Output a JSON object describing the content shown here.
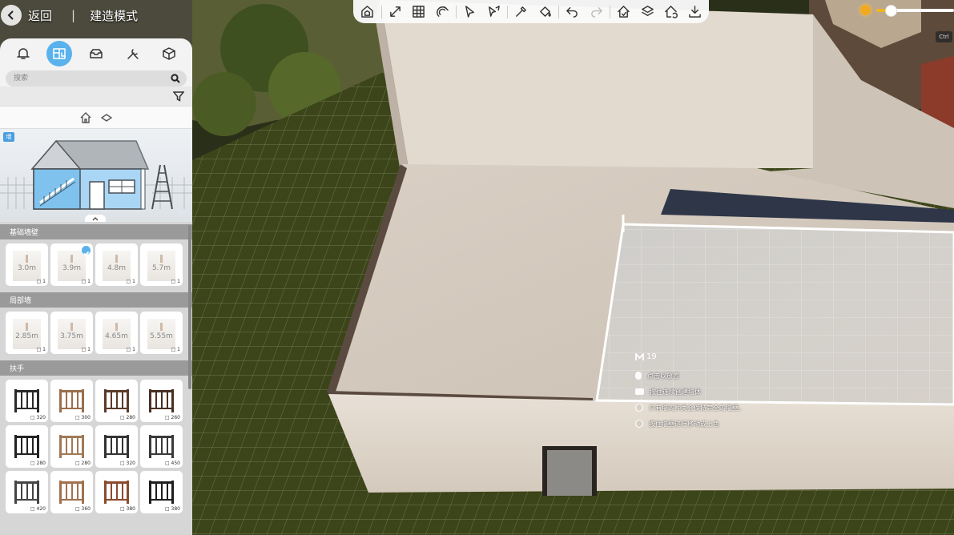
{
  "topbar": {
    "back_label": "返回",
    "separator": "|",
    "mode_title": "建造模式"
  },
  "toolbar": {
    "tools": [
      {
        "icon": "house-cube-icon",
        "enabled": true
      },
      {
        "icon": "diagonal-arrows-icon",
        "enabled": true
      },
      {
        "icon": "grid-icon",
        "enabled": true
      },
      {
        "icon": "magnet-icon",
        "enabled": true
      },
      {
        "icon": "pointer-icon",
        "enabled": true
      },
      {
        "icon": "pointer-paint-icon",
        "enabled": true
      },
      {
        "icon": "eyedropper-icon",
        "enabled": true
      },
      {
        "icon": "paint-bucket-icon",
        "enabled": true
      },
      {
        "icon": "undo-icon",
        "enabled": true
      },
      {
        "icon": "redo-icon",
        "enabled": false
      },
      {
        "icon": "house-check-icon",
        "enabled": true
      },
      {
        "icon": "layers-icon",
        "enabled": true
      },
      {
        "icon": "house-cycle-icon",
        "enabled": true
      },
      {
        "icon": "download-icon",
        "enabled": true
      }
    ]
  },
  "time_slider": {
    "value": 0.18,
    "color": "#f2b31f"
  },
  "ctrl_key": "Ctrl",
  "panel": {
    "category_tabs": [
      {
        "icon": "bell-icon",
        "active": false
      },
      {
        "icon": "wall-panel-icon",
        "active": true
      },
      {
        "icon": "mailbox-icon",
        "active": false
      },
      {
        "icon": "tools-icon",
        "active": false
      },
      {
        "icon": "package-icon",
        "active": false
      }
    ],
    "search": {
      "placeholder": "搜索",
      "value": ""
    },
    "preview_badge": "墙",
    "sections": [
      {
        "title": "基础墙壁",
        "kind": "wall",
        "items": [
          {
            "label": "3.0m",
            "count": "1",
            "selected": false
          },
          {
            "label": "3.9m",
            "count": "1",
            "selected": true
          },
          {
            "label": "4.8m",
            "count": "1",
            "selected": false
          },
          {
            "label": "5.7m",
            "count": "1",
            "selected": false
          }
        ]
      },
      {
        "title": "局部墙",
        "kind": "wall",
        "items": [
          {
            "label": "2.85m",
            "count": "1",
            "selected": false
          },
          {
            "label": "3.75m",
            "count": "1",
            "selected": false
          },
          {
            "label": "4.65m",
            "count": "1",
            "selected": false
          },
          {
            "label": "5.55m",
            "count": "1",
            "selected": false
          }
        ]
      },
      {
        "title": "扶手",
        "kind": "rail",
        "items": [
          {
            "count": "320",
            "color": "#2a2a2a"
          },
          {
            "count": "300",
            "color": "#9b6e4c"
          },
          {
            "count": "280",
            "color": "#5a3b2a"
          },
          {
            "count": "260",
            "color": "#4a3023"
          },
          {
            "count": "280",
            "color": "#222222"
          },
          {
            "count": "280",
            "color": "#a07a55"
          },
          {
            "count": "320",
            "color": "#333333"
          },
          {
            "count": "450",
            "color": "#3a3a3a"
          },
          {
            "count": "420",
            "color": "#444444"
          },
          {
            "count": "360",
            "color": "#a0724e"
          },
          {
            "count": "380",
            "color": "#8b4a2e"
          },
          {
            "count": "380",
            "color": "#1e1e1e"
          }
        ]
      }
    ]
  },
  "hints": {
    "price": "19",
    "lines": [
      {
        "icon": "mouse-left-icon",
        "text": "点击以放置"
      },
      {
        "icon": "keyboard-icon",
        "text": "按住连续创建墙体"
      },
      {
        "icon": "info-icon",
        "text": "只有墙的种类会保持完全的墙壁。"
      },
      {
        "icon": "info-icon",
        "text": "按住墙壁进行移动或上色"
      }
    ]
  }
}
